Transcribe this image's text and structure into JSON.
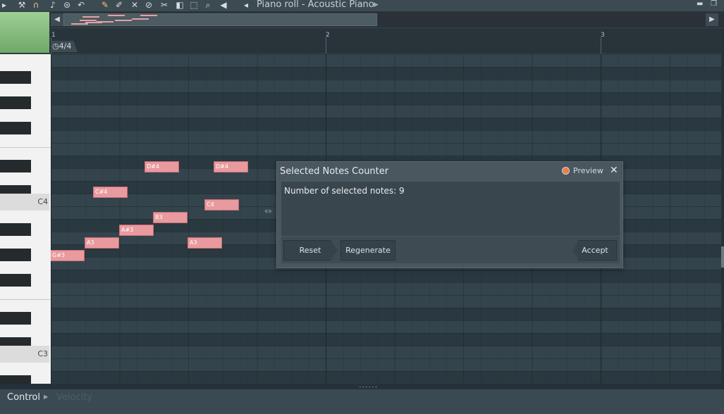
{
  "window": {
    "title": "Piano roll - Acoustic Piano"
  },
  "toolbar_icons": [
    "play-arrow-icon",
    "wrench-icon",
    "magnet-icon",
    "note-icon",
    "menu-circle-icon",
    "undo-icon",
    "pencil-icon",
    "paint-brush-icon",
    "delete-brush-icon",
    "mute-brush-icon",
    "slice-icon",
    "select-icon",
    "zoom-icon",
    "playback-icon",
    "speaker-icon"
  ],
  "timeline": {
    "bars": [
      "1",
      "2",
      "3"
    ],
    "time_signature": "4/4"
  },
  "keyboard": {
    "labels": [
      "C4",
      "C3"
    ]
  },
  "notes": [
    {
      "label": "D#4"
    },
    {
      "label": "D#4"
    },
    {
      "label": "C#4"
    },
    {
      "label": "C4"
    },
    {
      "label": "B3"
    },
    {
      "label": "A#3"
    },
    {
      "label": "A3"
    },
    {
      "label": "A3"
    },
    {
      "label": "G#3"
    }
  ],
  "dialog": {
    "title": "Selected Notes Counter",
    "preview_label": "Preview",
    "message": "Number of selected notes: 9",
    "buttons": {
      "reset": "Reset",
      "regenerate": "Regenerate",
      "accept": "Accept"
    }
  },
  "bottom_panel": {
    "control_label": "Control",
    "velocity_label": "Velocity"
  }
}
